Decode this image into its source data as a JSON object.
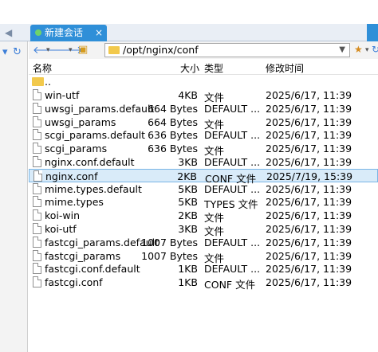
{
  "tabs": {
    "active_label": "新建会话",
    "close": "×"
  },
  "toolbar": {
    "path": "/opt/nginx/conf"
  },
  "columns": {
    "name": "名称",
    "size": "大小",
    "type": "类型",
    "mtime": "修改时间"
  },
  "parent_entry": "..",
  "files": [
    {
      "name": "win-utf",
      "size": "4KB",
      "type": "文件",
      "mtime": "2025/6/17, 11:39",
      "selected": false
    },
    {
      "name": "uwsgi_params.default",
      "size": "664 Bytes",
      "type": "DEFAULT ...",
      "mtime": "2025/6/17, 11:39",
      "selected": false
    },
    {
      "name": "uwsgi_params",
      "size": "664 Bytes",
      "type": "文件",
      "mtime": "2025/6/17, 11:39",
      "selected": false
    },
    {
      "name": "scgi_params.default",
      "size": "636 Bytes",
      "type": "DEFAULT ...",
      "mtime": "2025/6/17, 11:39",
      "selected": false
    },
    {
      "name": "scgi_params",
      "size": "636 Bytes",
      "type": "文件",
      "mtime": "2025/6/17, 11:39",
      "selected": false
    },
    {
      "name": "nginx.conf.default",
      "size": "3KB",
      "type": "DEFAULT ...",
      "mtime": "2025/6/17, 11:39",
      "selected": false
    },
    {
      "name": "nginx.conf",
      "size": "2KB",
      "type": "CONF 文件",
      "mtime": "2025/7/19, 15:39",
      "selected": true
    },
    {
      "name": "mime.types.default",
      "size": "5KB",
      "type": "DEFAULT ...",
      "mtime": "2025/6/17, 11:39",
      "selected": false
    },
    {
      "name": "mime.types",
      "size": "5KB",
      "type": "TYPES 文件",
      "mtime": "2025/6/17, 11:39",
      "selected": false
    },
    {
      "name": "koi-win",
      "size": "2KB",
      "type": "文件",
      "mtime": "2025/6/17, 11:39",
      "selected": false
    },
    {
      "name": "koi-utf",
      "size": "3KB",
      "type": "文件",
      "mtime": "2025/6/17, 11:39",
      "selected": false
    },
    {
      "name": "fastcgi_params.default",
      "size": "1007 Bytes",
      "type": "DEFAULT ...",
      "mtime": "2025/6/17, 11:39",
      "selected": false
    },
    {
      "name": "fastcgi_params",
      "size": "1007 Bytes",
      "type": "文件",
      "mtime": "2025/6/17, 11:39",
      "selected": false
    },
    {
      "name": "fastcgi.conf.default",
      "size": "1KB",
      "type": "DEFAULT ...",
      "mtime": "2025/6/17, 11:39",
      "selected": false
    },
    {
      "name": "fastcgi.conf",
      "size": "1KB",
      "type": "CONF 文件",
      "mtime": "2025/6/17, 11:39",
      "selected": false
    }
  ],
  "colors": {
    "tab_active": "#2f8fd8",
    "selection": "#d9ebf9",
    "selection_border": "#79b5e6"
  }
}
